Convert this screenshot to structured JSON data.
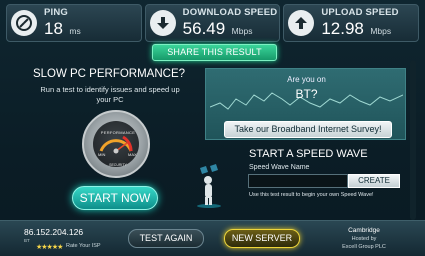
{
  "stats": {
    "ping": {
      "label": "PING",
      "value": "18",
      "unit": "ms",
      "icon": "ping-gauge-icon"
    },
    "download": {
      "label": "DOWNLOAD SPEED",
      "value": "56.49",
      "unit": "Mbps",
      "icon": "download-arrow-icon"
    },
    "upload": {
      "label": "UPLOAD SPEED",
      "value": "12.98",
      "unit": "Mbps",
      "icon": "upload-arrow-icon"
    }
  },
  "share_button": {
    "label": "SHARE THIS RESULT"
  },
  "promo": {
    "title": "SLOW PC PERFORMANCE?",
    "description": "Run a test to identify issues and speed up your PC",
    "gauge": {
      "top_label": "PERFORMANCE",
      "min": "MIN",
      "max": "MAX",
      "bottom_label": "SECURITY"
    },
    "start_button": "START NOW"
  },
  "survey": {
    "question_line1": "Are you on",
    "question_line2": "BT?",
    "button": "Take our Broadband Internet Survey!"
  },
  "speed_wave": {
    "title": "START A SPEED WAVE",
    "name_label": "Speed Wave Name",
    "input_value": "",
    "create_button": "CREATE",
    "help_text": "Use this test result to begin your own Speed Wave!"
  },
  "footer": {
    "ip": "86.152.204.126",
    "isp_sub": "BT",
    "stars": "★★★★★",
    "rate_isp": "Rate Your ISP",
    "test_again": "TEST AGAIN",
    "new_server": "NEW SERVER",
    "server_city": "Cambridge",
    "hosted_by": "Hosted by",
    "host_name": "Excell Group PLC"
  },
  "colors": {
    "share_green": "#1fd18f",
    "start_teal": "#19c7b6",
    "new_server_gold": "#e9cc2a",
    "survey_teal": "#2f6c72"
  }
}
